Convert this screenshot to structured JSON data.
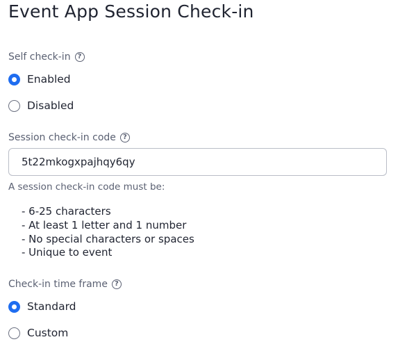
{
  "page": {
    "title": "Event App Session Check-in"
  },
  "self_checkin": {
    "label": "Self check-in",
    "help_icon": "question-circle-icon",
    "options": [
      {
        "label": "Enabled",
        "checked": true
      },
      {
        "label": "Disabled",
        "checked": false
      }
    ]
  },
  "session_code": {
    "label": "Session check-in code",
    "help_icon": "question-circle-icon",
    "value": "5t22mkogxpajhqy6qy",
    "hint": "A session check-in code must be:",
    "rules": [
      "- 6-25 characters",
      "- At least 1 letter and 1 number",
      "- No special characters or spaces",
      "- Unique to event"
    ]
  },
  "time_frame": {
    "label": "Check-in time frame",
    "help_icon": "question-circle-icon",
    "options": [
      {
        "label": "Standard",
        "checked": true
      },
      {
        "label": "Custom",
        "checked": false
      }
    ]
  },
  "colors": {
    "accent": "#1f6df0",
    "text": "#1f2330",
    "muted": "#5a6072",
    "border": "#b9bdc7"
  }
}
